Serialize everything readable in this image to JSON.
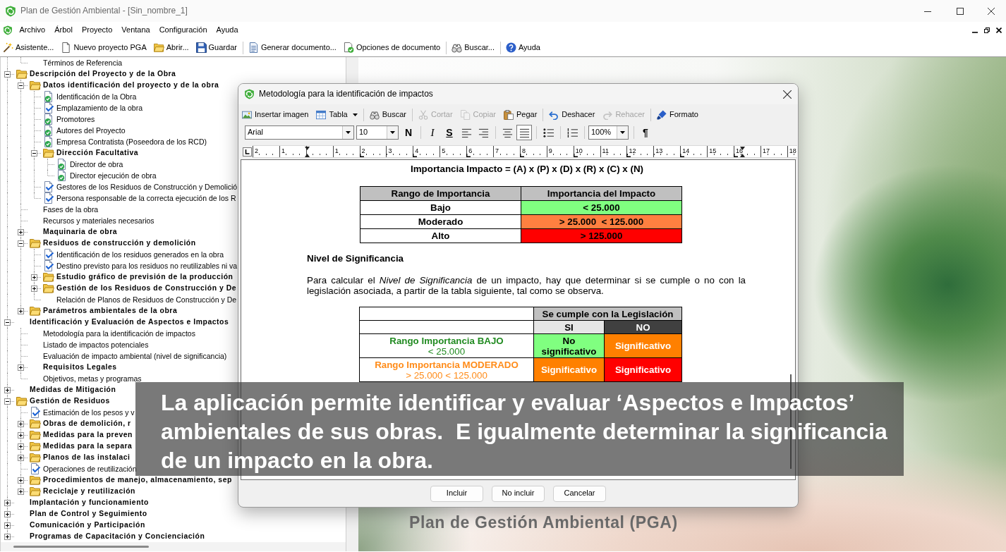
{
  "window": {
    "title": "Plan de Gestión Ambiental - [Sin_nombre_1]"
  },
  "menu": [
    "Archivo",
    "Árbol",
    "Proyecto",
    "Ventana",
    "Configuración",
    "Ayuda"
  ],
  "toolbar": [
    [
      {
        "label": "Asistente..."
      },
      {
        "label": "Nuevo proyecto PGA"
      },
      {
        "label": "Abrir..."
      },
      {
        "label": "Guardar"
      }
    ],
    [
      {
        "label": "Generar documento..."
      },
      {
        "label": "Opciones de documento"
      }
    ],
    [
      {
        "label": "Buscar..."
      }
    ],
    [
      {
        "label": "Ayuda"
      }
    ]
  ],
  "tree": {
    "items": [
      {
        "children": [
          {
            "kind": "topic",
            "label": "Términos de Referencia"
          }
        ]
      },
      {
        "kind": "folder",
        "label": "Descripción del Proyecto y de la Obra",
        "expanded": true,
        "children": [
          {
            "kind": "folder",
            "label": "Datos identificación del proyecto y de la obra",
            "expanded": true,
            "children": [
              {
                "kind": "document",
                "label": "Identificación de la Obra",
                "done": true
              },
              {
                "kind": "document",
                "label": "Emplazamiento de la obra",
                "done": false
              },
              {
                "kind": "document",
                "label": "Promotores",
                "done": true
              },
              {
                "kind": "document",
                "label": "Autores del Proyecto",
                "done": true
              },
              {
                "kind": "document",
                "label": "Empresa Contratista (Poseedora de los RCD)",
                "done": true
              },
              {
                "kind": "folder",
                "label": "Dirección Facultativa",
                "expanded": true,
                "children": [
                  {
                    "kind": "document",
                    "label": "Director de obra",
                    "done": true
                  },
                  {
                    "kind": "document",
                    "label": "Director ejecución de obra",
                    "done": true
                  }
                ]
              },
              {
                "kind": "document",
                "label": "Gestores de los Residuos de Construcción y Demolició",
                "done": false
              },
              {
                "kind": "document",
                "label": "Persona responsable de la correcta ejecución de los R",
                "done": false
              }
            ]
          },
          {
            "kind": "topic",
            "label": "Fases de la obra"
          },
          {
            "kind": "topic",
            "label": "Recursos y materiales necesarios"
          },
          {
            "kind": "section",
            "label": "Maquinaria de obra",
            "expanded": false
          },
          {
            "kind": "folder",
            "label": "Residuos de construcción y demolición",
            "expanded": true,
            "children": [
              {
                "kind": "document",
                "label": "Identificación de los residuos generados en la obra",
                "done": false
              },
              {
                "kind": "document",
                "label": "Destino previsto para los residuos no reutilizables ni va",
                "done": false
              },
              {
                "kind": "folder",
                "label": "Estudio gráfico de previsión de la producción",
                "expanded": false
              },
              {
                "kind": "folder",
                "label": "Gestión de los Residuos de Construcción y De",
                "expanded": false
              },
              {
                "kind": "topic",
                "label": "Relación de Planos de Residuos de Construcción y De"
              }
            ]
          },
          {
            "kind": "folder",
            "label": "Parámetros ambientales de la obra",
            "expanded": false
          }
        ]
      },
      {
        "kind": "section",
        "label": "Identificación y Evaluación de Aspectos e Impactos",
        "expanded": true,
        "children": [
          {
            "kind": "topic",
            "label": "Metodología para la identificación de impactos"
          },
          {
            "kind": "topic",
            "label": "Listado de impactos potenciales"
          },
          {
            "kind": "topic",
            "label": "Evaluación de impacto ambiental (nivel de significancia)"
          },
          {
            "kind": "section",
            "label": "Requisitos Legales",
            "expanded": false
          },
          {
            "kind": "topic",
            "label": "Objetivos, metas y programas"
          }
        ]
      },
      {
        "kind": "section",
        "label": "Medidas de Mitigación",
        "expanded": false
      },
      {
        "kind": "folder",
        "label": "Gestión de Residuos",
        "expanded": true,
        "children": [
          {
            "kind": "document",
            "label": "Estimación de los pesos y v",
            "done": false
          },
          {
            "kind": "folder",
            "label": "Obras de demolición, r",
            "expanded": false
          },
          {
            "kind": "folder",
            "label": "Medidas para la preven",
            "expanded": false
          },
          {
            "kind": "folder",
            "label": "Medidas para la separa",
            "expanded": false
          },
          {
            "kind": "folder",
            "label": "Planos de las instalaci",
            "expanded": false
          },
          {
            "kind": "document",
            "label": "Operaciones de reutilización",
            "done": false
          },
          {
            "kind": "folder",
            "label": "Procedimientos de manejo, almacenamiento, sep",
            "expanded": false
          },
          {
            "kind": "folder",
            "label": "Reciclaje y reutilización",
            "expanded": false
          }
        ]
      },
      {
        "kind": "section",
        "label": "Implantación y funcionamiento",
        "expanded": false
      },
      {
        "kind": "section",
        "label": "Plan de Control y Seguimiento",
        "expanded": false
      },
      {
        "kind": "section",
        "label": "Comunicación y Participación",
        "expanded": false
      },
      {
        "kind": "section",
        "label": "Programas de Capacitación y Concienciación",
        "expanded": false
      }
    ]
  },
  "background": {
    "caption": "Plan de Gestión Ambiental (PGA)"
  },
  "dialog": {
    "title": "Metodología para la identificación de impactos",
    "toolbar": [
      [
        {
          "label": "Insertar imagen",
          "disabled": false,
          "dropdown": false
        },
        {
          "label": "Tabla",
          "disabled": false,
          "dropdown": true
        }
      ],
      [
        {
          "label": "Buscar",
          "disabled": false,
          "dropdown": false
        }
      ],
      [
        {
          "label": "Cortar",
          "disabled": true,
          "dropdown": false
        },
        {
          "label": "Copiar",
          "disabled": true,
          "dropdown": false
        },
        {
          "label": "Pegar",
          "disabled": false,
          "dropdown": false
        }
      ],
      [
        {
          "label": "Deshacer",
          "disabled": false,
          "dropdown": false
        },
        {
          "label": "Rehacer",
          "disabled": true,
          "dropdown": false
        }
      ],
      [
        {
          "label": "Formato",
          "disabled": false,
          "dropdown": false
        }
      ]
    ],
    "format_bar": [
      [
        {
          "kind": "combo",
          "value": "Arial"
        },
        {
          "kind": "combo",
          "value": "10"
        },
        {
          "kind": "bold",
          "label": "N",
          "selected": false
        }
      ],
      [
        {
          "kind": "italic",
          "label": "I",
          "selected": false
        },
        {
          "kind": "underline",
          "label": "S",
          "selected": false
        },
        {
          "kind": "icon",
          "selected": false
        },
        {
          "kind": "icon",
          "selected": false
        }
      ],
      [
        {
          "kind": "icon",
          "selected": false
        },
        {
          "kind": "icon",
          "selected": true
        }
      ],
      [
        {
          "kind": "icon",
          "selected": false
        }
      ],
      [
        {
          "kind": "icon",
          "selected": false
        }
      ],
      [
        {
          "kind": "combo",
          "value": "100%"
        }
      ],
      [
        {
          "kind": "text",
          "label": "¶",
          "selected": false
        }
      ]
    ],
    "ruler": {
      "left_labels": [
        "2",
        "1"
      ],
      "right_labels": [
        "1",
        "2",
        "3",
        "4",
        "5",
        "6",
        "7",
        "8",
        "9",
        "10",
        "11",
        "12",
        "13",
        "14",
        "15",
        "16",
        "17",
        "18"
      ]
    },
    "document": {
      "formula": "Importancia Impacto = (A) x (P) x (D) x (R) x (C) x (N)",
      "importance_table": {
        "columns": [
          "Rango de Importancia",
          "Importancia del Impacto"
        ],
        "rows": [
          {
            "range": "Bajo",
            "value": "< 25.000",
            "color": "#80ff80"
          },
          {
            "range": "Moderado",
            "value": "> 25.000  < 125.000",
            "color": "#ff8040"
          },
          {
            "range": "Alto",
            "value": "> 125.000",
            "color": "#ff0000"
          }
        ]
      },
      "heading": "Nivel de Significancia",
      "intro": "Para calcular el *Nivel de Significancia* de un impacto, hay que determinar si se cumple o no con la legislación asociada, a partir de la tabla siguiente, tal como se observa.",
      "significance_table": {
        "group_header": "Se cumple con la Legislación",
        "columns": [
          {
            "label": "SI",
            "color": "#e6e6e6"
          },
          {
            "label": "NO",
            "color": "#404040"
          }
        ],
        "rows": [
          {
            "label": "Rango Importancia BAJO",
            "range": "< 25.000",
            "color": "#228b22",
            "cells": [
              {
                "text": "No significativo",
                "color": "#80ff80"
              },
              {
                "text": "Significativo",
                "color": "#ff8000"
              }
            ]
          },
          {
            "label": "Rango Importancia MODERADO",
            "range": "> 25.000 < 125.000",
            "color": "#ff8c1a",
            "cells": [
              {
                "text": "Significativo",
                "color": "#ff8000"
              },
              {
                "text": "Significativo",
                "color": "#ff0000"
              }
            ]
          }
        ]
      }
    },
    "buttons": [
      "Incluir",
      "No incluir",
      "Cancelar"
    ]
  },
  "overlay_caption": {
    "text": "La aplicación permite identificar y evaluar ‘Aspectos e Impactos’\nambientales de sus obras.  E igualmente determinar la significancia\nde un impacto en la obra."
  }
}
